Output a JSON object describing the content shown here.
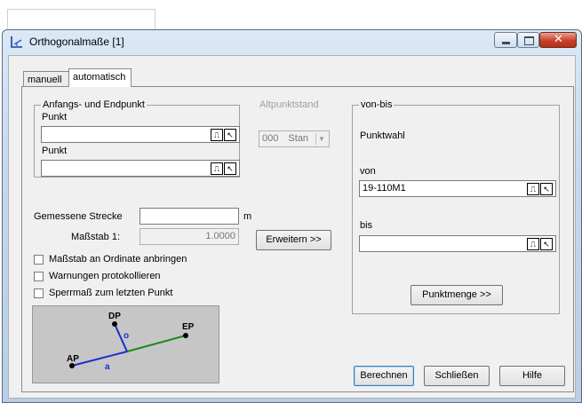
{
  "window": {
    "title": "Orthogonalmaße [1]"
  },
  "tabs": [
    {
      "label": "manuell",
      "active": false
    },
    {
      "label": "automatisch",
      "active": true
    }
  ],
  "start_end": {
    "legend": "Anfangs- und Endpunkt",
    "punkt1_label": "Punkt",
    "punkt1_value": "",
    "punkt2_label": "Punkt",
    "punkt2_value": ""
  },
  "altpunktstand": {
    "label": "Altpunktstand",
    "value": "000",
    "suffix": "Stan"
  },
  "von_bis": {
    "legend": "von-bis",
    "punktwahl_label": "Punktwahl",
    "von_label": "von",
    "von_value": "19-110M1",
    "bis_label": "bis",
    "bis_value": "",
    "punktmenge_button": "Punktmenge >>"
  },
  "measure": {
    "gemessene_label": "Gemessene Strecke",
    "gemessene_value": "",
    "unit": "m",
    "massstab_label": "Maßstab 1:",
    "massstab_value": "1.0000",
    "erweitern_button": "Erweitern >>"
  },
  "options": [
    {
      "label": "Maßstab an Ordinate anbringen",
      "checked": false
    },
    {
      "label": "Warnungen protokollieren",
      "checked": false
    },
    {
      "label": "Sperrmaß zum letzten Punkt",
      "checked": false
    }
  ],
  "diagram_labels": {
    "dp": "DP",
    "ep": "EP",
    "ap": "AP",
    "o": "o",
    "a": "a"
  },
  "footer": {
    "berechnen": "Berechnen",
    "schliessen": "Schließen",
    "hilfe": "Hilfe"
  },
  "colors": {
    "ordinate": "#1a2ecc",
    "baseline_green": "#1a8a1a",
    "baseline_blue": "#1a2ecc"
  }
}
